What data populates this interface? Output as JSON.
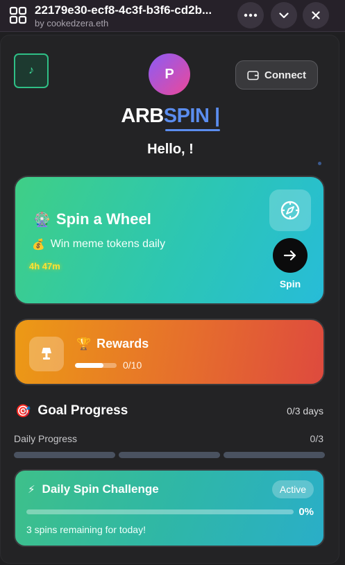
{
  "topbar": {
    "title": "22179e30-ecf8-4c3f-b3f6-cd2b...",
    "subtitle": "by cookedzera.eth",
    "icons": [
      "app-grid-icon",
      "more-icon",
      "chevron-down-icon",
      "close-icon"
    ]
  },
  "header": {
    "music_icon": "♪",
    "avatar_initial": "P",
    "connect_label": "Connect",
    "brand_part1": "ARB",
    "brand_part2": "SPIN |",
    "greeting": "Hello, !"
  },
  "spin_card": {
    "emoji": "🎡",
    "title": "Spin a Wheel",
    "desc_emoji": "💰",
    "description": "Win meme tokens daily",
    "timer": "4h 47m",
    "button_label": "Spin"
  },
  "rewards_card": {
    "emoji": "🏆",
    "title": "Rewards",
    "count": "0/10",
    "progress": 0.68
  },
  "goal": {
    "emoji": "🎯",
    "title": "Goal Progress",
    "days": "0/3 days",
    "daily_label": "Daily Progress",
    "daily_count": "0/3",
    "segments": [
      false,
      false,
      false
    ]
  },
  "challenge": {
    "emoji": "⚡",
    "title": "Daily Spin Challenge",
    "status": "Active",
    "percent": "0%",
    "progress": 0,
    "note": "3 spins remaining for today!"
  },
  "colors": {
    "accent_blue": "#5b8def",
    "spin_green": "#3fcf86",
    "spin_cyan": "#27bcd8",
    "rewards_orange": "#ec9a15",
    "rewards_red": "#de4a3e",
    "timer_yellow": "#ffe033"
  }
}
